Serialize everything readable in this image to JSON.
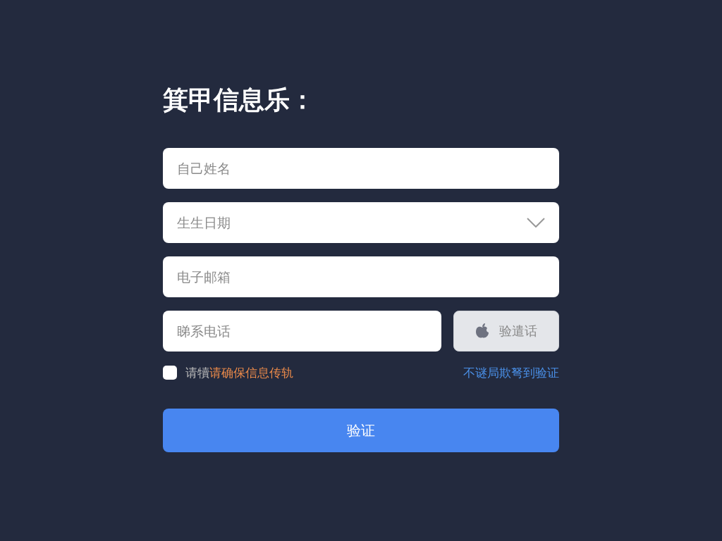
{
  "title": "箕甲信息乐：",
  "fields": [
    {
      "kind": "text",
      "placeholder": "自己姓名"
    },
    {
      "kind": "select",
      "placeholder": "生生日期"
    },
    {
      "kind": "text",
      "placeholder": "电子邮箱"
    }
  ],
  "phone": {
    "placeholder": "睇系电话",
    "code_button": "验遣话"
  },
  "agreement": {
    "checked": false,
    "prefix": "请犢",
    "text": "请确保信息传轨"
  },
  "link": "不谜局欺弩到验证",
  "submit": "验证"
}
